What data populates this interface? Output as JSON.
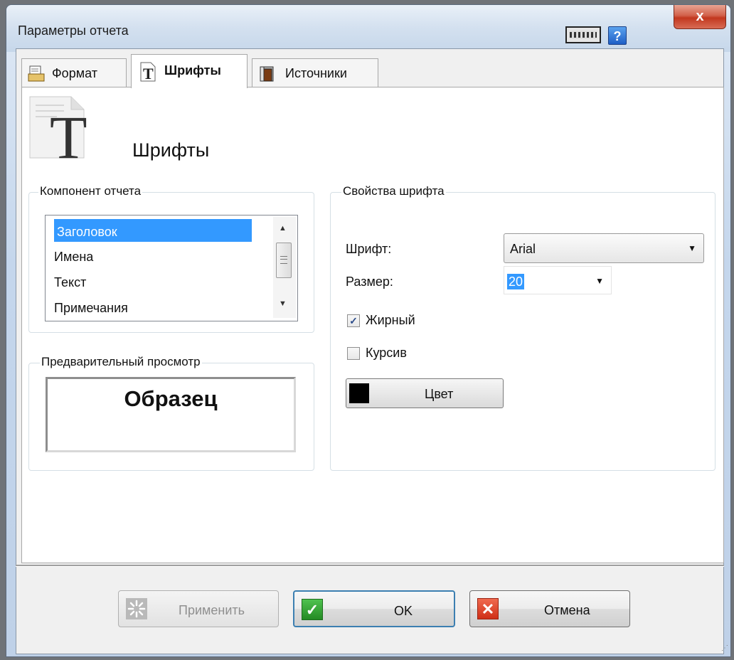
{
  "window": {
    "title": "Параметры отчета",
    "close_label": "x",
    "help_label": "?"
  },
  "tabs": [
    {
      "label": "Формат",
      "icon": "format-page-icon",
      "active": false
    },
    {
      "label": "Шрифты",
      "icon": "font-t-icon",
      "active": true
    },
    {
      "label": "Источники",
      "icon": "sources-book-icon",
      "active": false
    }
  ],
  "page": {
    "title": "Шрифты",
    "icon": "font-document-T-icon"
  },
  "report_component": {
    "legend": "Компонент отчета",
    "items": [
      "Заголовок",
      "Имена",
      "Текст",
      "Примечания"
    ],
    "selected": "Заголовок"
  },
  "preview": {
    "legend": "Предварительный просмотр",
    "sample_text": "Образец"
  },
  "font_properties": {
    "legend": "Свойства шрифта",
    "font_label": "Шрифт:",
    "font_value": "Arial",
    "size_label": "Размер:",
    "size_value": "20",
    "bold_label": "Жирный",
    "bold_checked": true,
    "italic_label": "Курсив",
    "italic_checked": false,
    "color_button_label": "Цвет",
    "color_value": "#000000"
  },
  "footer": {
    "apply_label": "Применить",
    "ok_label": "OK",
    "cancel_label": "Отмена"
  },
  "colors": {
    "selection": "#3399ff",
    "close_button": "#c2381f",
    "ok_icon": "#2e9b2e",
    "cancel_icon": "#d9402a"
  }
}
